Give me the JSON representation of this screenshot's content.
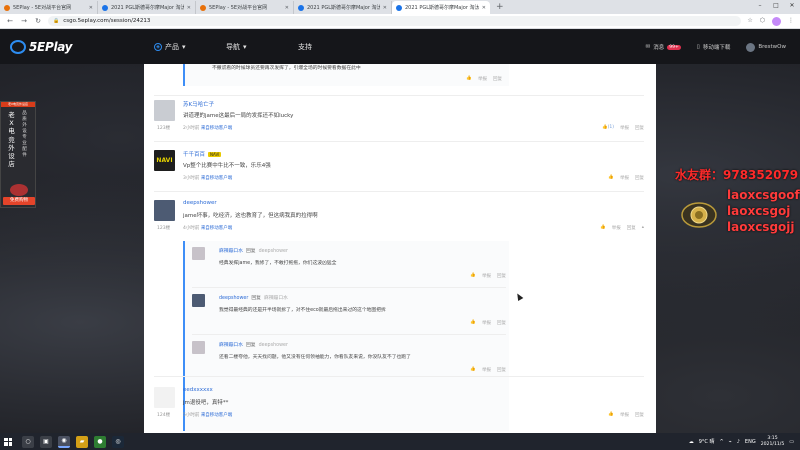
{
  "browser": {
    "tabs": [
      {
        "title": "5EPlay - 5E对战平台官网",
        "active": false
      },
      {
        "title": "2021 PGL斯德哥尔摩Major 淘汰...",
        "active": false
      },
      {
        "title": "5EPlay - 5E对战平台官网",
        "active": false
      },
      {
        "title": "2021 PGL斯德哥尔摩Major 淘汰...",
        "active": false
      },
      {
        "title": "2021 PGL斯德哥尔摩Major 淘汰...",
        "active": true
      }
    ],
    "new_tab": "+",
    "url": "csgo.5eplay.com/session/24213"
  },
  "site": {
    "logo": "5EPlay",
    "nav": [
      {
        "label": "产品",
        "icon": "product-icon"
      },
      {
        "label": "导航",
        "icon": "menu-icon"
      },
      {
        "label": "支持",
        "icon": ""
      }
    ],
    "header_right": {
      "message_label": "消息",
      "message_badge": "99+",
      "download_label": "移动端下载",
      "username": "BrestwOw"
    }
  },
  "promo": {
    "banner": "老X电竞外设店",
    "col1": [
      "老",
      "X",
      "电",
      "竞",
      "外",
      "设",
      "店"
    ],
    "col2": [
      "品",
      "质",
      "外",
      "设",
      "专",
      "业",
      "配",
      "件"
    ],
    "button": "免费购物"
  },
  "overlay": {
    "qq": "水友群：978352079",
    "lines": [
      "laoxcsgoof",
      "laoxcsgoj",
      "laoxcsgojj"
    ]
  },
  "comments": {
    "top_partial_text": "不撒谎看的时候球员还要再次发挥了，引爆全场的时候要看数据在此中",
    "items": [
      {
        "user": "苏K马哈亡子",
        "text": "讲道理的jame这最后一局的发挥还不如lucky",
        "floor": "123楼",
        "meta_time": "2小时前",
        "meta_link": "来自移动客户端",
        "likes": "(1)",
        "reply": "举报",
        "more": "回复"
      },
      {
        "user": "千千百百",
        "tag": "NAVI",
        "text": "Vp整个比赛中牛比不一致，乐乐4强",
        "floor": "",
        "meta_time": "3小时前",
        "meta_link": "来自移动客户端",
        "likes": "",
        "reply": "举报",
        "more": "回复"
      },
      {
        "user": "deepshower",
        "text": "jame坏事，吃经济，这也教育了，但这病我真的拉得啊",
        "floor": "123楼",
        "meta_time": "4小时前",
        "meta_link": "来自移动客户端",
        "likes": "",
        "reply": "举报",
        "more": "回复"
      },
      {
        "user": "eedxxxxxx",
        "text": "jm退役吧，真特**",
        "floor": "124楼",
        "meta_time": "5小时前",
        "meta_link": "来自移动客户端",
        "likes": "",
        "reply": "举报",
        "more": "回复"
      }
    ],
    "replies": [
      {
        "user": "麻辣蹦口水",
        "reply_word": "回复",
        "target": "deepshower",
        "text": "经典发挥jame，我修了，不敢打拖拖，你们这波凶猛全",
        "like": "",
        "report": "举报",
        "respond": "回复"
      },
      {
        "user": "deepshower",
        "reply_word": "回复",
        "target": "麻辣蹦口水",
        "text": "我觉得最经典的还是开半场就拆了，对不住eco就最后拖出来过的这个地图把拆",
        "like": "",
        "report": "举报",
        "respond": "回复"
      },
      {
        "user": "麻辣蹦口水",
        "reply_word": "回复",
        "target": "deepshower",
        "text": "还看二楼夸他，天天找问题，他又没有任何领袖能力，你看队友来说，你没队友不了也跑了",
        "like": "",
        "report": "举报",
        "respond": "回复"
      }
    ]
  },
  "taskbar": {
    "weather": "9°C 晴",
    "lang": "ENG",
    "time": "3:15",
    "date": "2021/11/5"
  }
}
